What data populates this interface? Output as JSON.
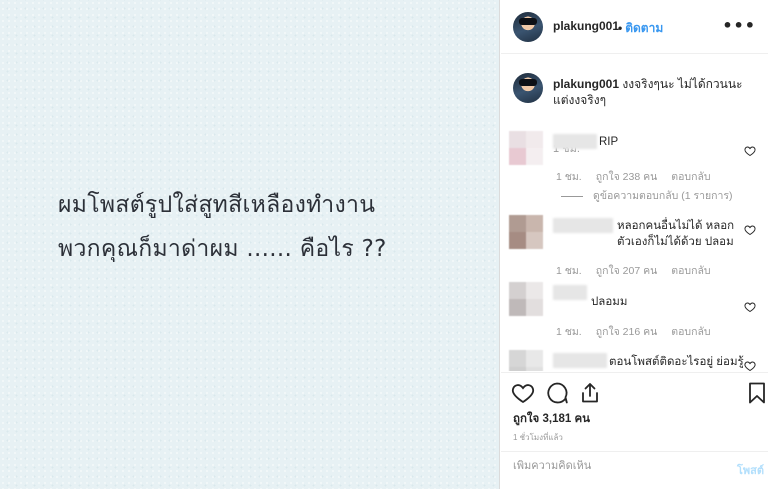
{
  "post_image": {
    "line1": "ผมโพสต์รูปใส่สูทสีเหลืองทำงาน",
    "line2": "พวกคุณก็มาด่าผม ...... คือไร ??",
    "background_color": "#e7f1f4"
  },
  "header": {
    "username": "plakung001",
    "dot": "•",
    "follow_label": "ติดตาม",
    "more_icon": "more-horizontal-icon"
  },
  "caption": {
    "username": "plakung001",
    "text": "งงจริงๆนะ ไม่ได้กวนนะ แต่งงจริงๆ",
    "time": "1 ชม."
  },
  "comments": [
    {
      "text": "RIP",
      "time": "1 ชม.",
      "likes": "ถูกใจ 238 คน",
      "reply_label": "ตอบกลับ",
      "view_replies": "ดูข้อความตอบกลับ (1 รายการ)"
    },
    {
      "text": "หลอกคนอื่นไม่ได้ หลอกตัวเองก็ไม่ได้ด้วย ปลอม",
      "time": "1 ชม.",
      "likes": "ถูกใจ 207 คน",
      "reply_label": "ตอบกลับ"
    },
    {
      "text": "ปลอมม",
      "time": "1 ชม.",
      "likes": "ถูกใจ 216 คน",
      "reply_label": "ตอบกลับ"
    },
    {
      "text": "ตอนโพสต์ติดอะไรอยู่ ย่อมรู้"
    }
  ],
  "actions": {
    "like_icon": "heart-icon",
    "comment_icon": "comment-icon",
    "share_icon": "share-icon",
    "save_icon": "bookmark-icon",
    "likes": "ถูกใจ 3,181 คน",
    "time": "1 ชั่วโมงที่แล้ว"
  },
  "add_comment": {
    "placeholder": "เพิ่มความคิดเห็น",
    "post_label": "โพสต์"
  },
  "colors": {
    "link": "#3897f0",
    "muted": "#999999",
    "post_disabled": "#b2dffc"
  }
}
